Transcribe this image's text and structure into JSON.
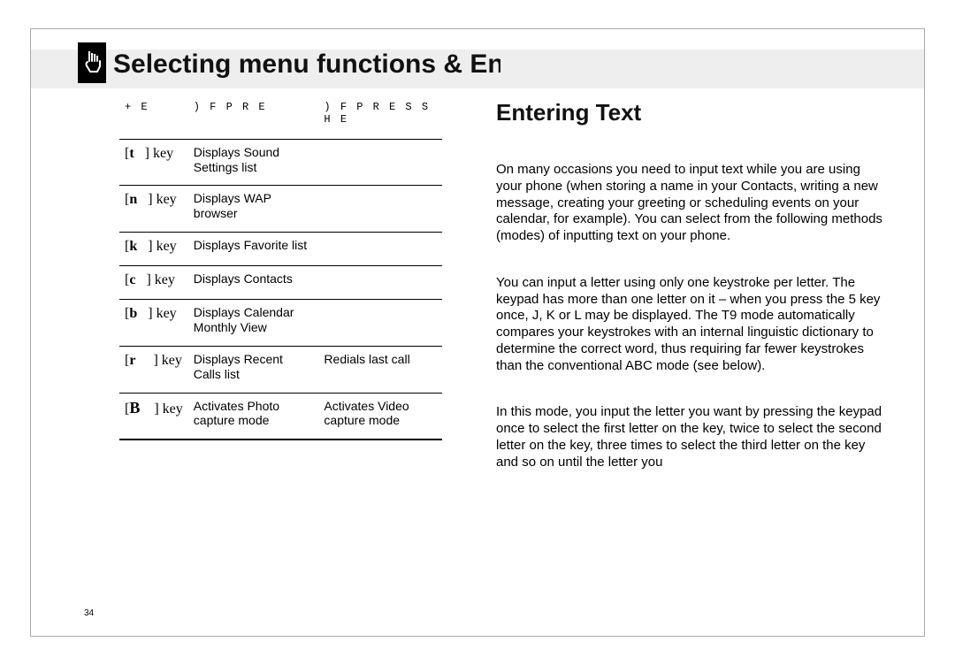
{
  "chapter_title": "Selecting menu functions & Enteri",
  "table": {
    "headers": [
      "+ E",
      ") F  P R E",
      ") F  P R E S S\nH E"
    ],
    "rows": [
      {
        "key": "t",
        "col1": "Displays Sound Settings list",
        "col2": ""
      },
      {
        "key": "n",
        "col1": "Displays WAP browser",
        "col2": ""
      },
      {
        "key": "k",
        "col1": "Displays Favorite list",
        "col2": ""
      },
      {
        "key": "c",
        "col1": "Displays Contacts",
        "col2": ""
      },
      {
        "key": "b",
        "col1": "Displays Calendar Monthly View",
        "col2": ""
      },
      {
        "key": "r",
        "col1": "Displays Recent Calls list",
        "col2": "Redials last call"
      },
      {
        "key": "B",
        "col1": "Activates Photo capture mode",
        "col2": "Activates Video capture mode"
      }
    ]
  },
  "page_number": "34",
  "right": {
    "heading": "Entering Text",
    "intro": "On many occasions you need to input text while you are using your phone (when storing a name in your Contacts, writing a new message, creating your greeting or scheduling events on your calendar, for example). You can select from the following methods (modes) of inputting text on your phone.",
    "t9_heading": "",
    "t9_body": "You can input a letter using only one keystroke per letter. The keypad has more than one letter on it – when you press the 5 key once, J, K or L may be displayed. The T9 mode automatically compares your keystrokes with an internal linguistic dictionary to determine the correct word, thus requiring far fewer keystrokes than the conventional ABC mode (see below).",
    "abc_heading": "",
    "abc_body": "In this mode, you input the letter you want by pressing the keypad once to select the first letter on the key, twice to select the second letter on the key, three times to select the third letter on the key and so on until the letter you"
  }
}
